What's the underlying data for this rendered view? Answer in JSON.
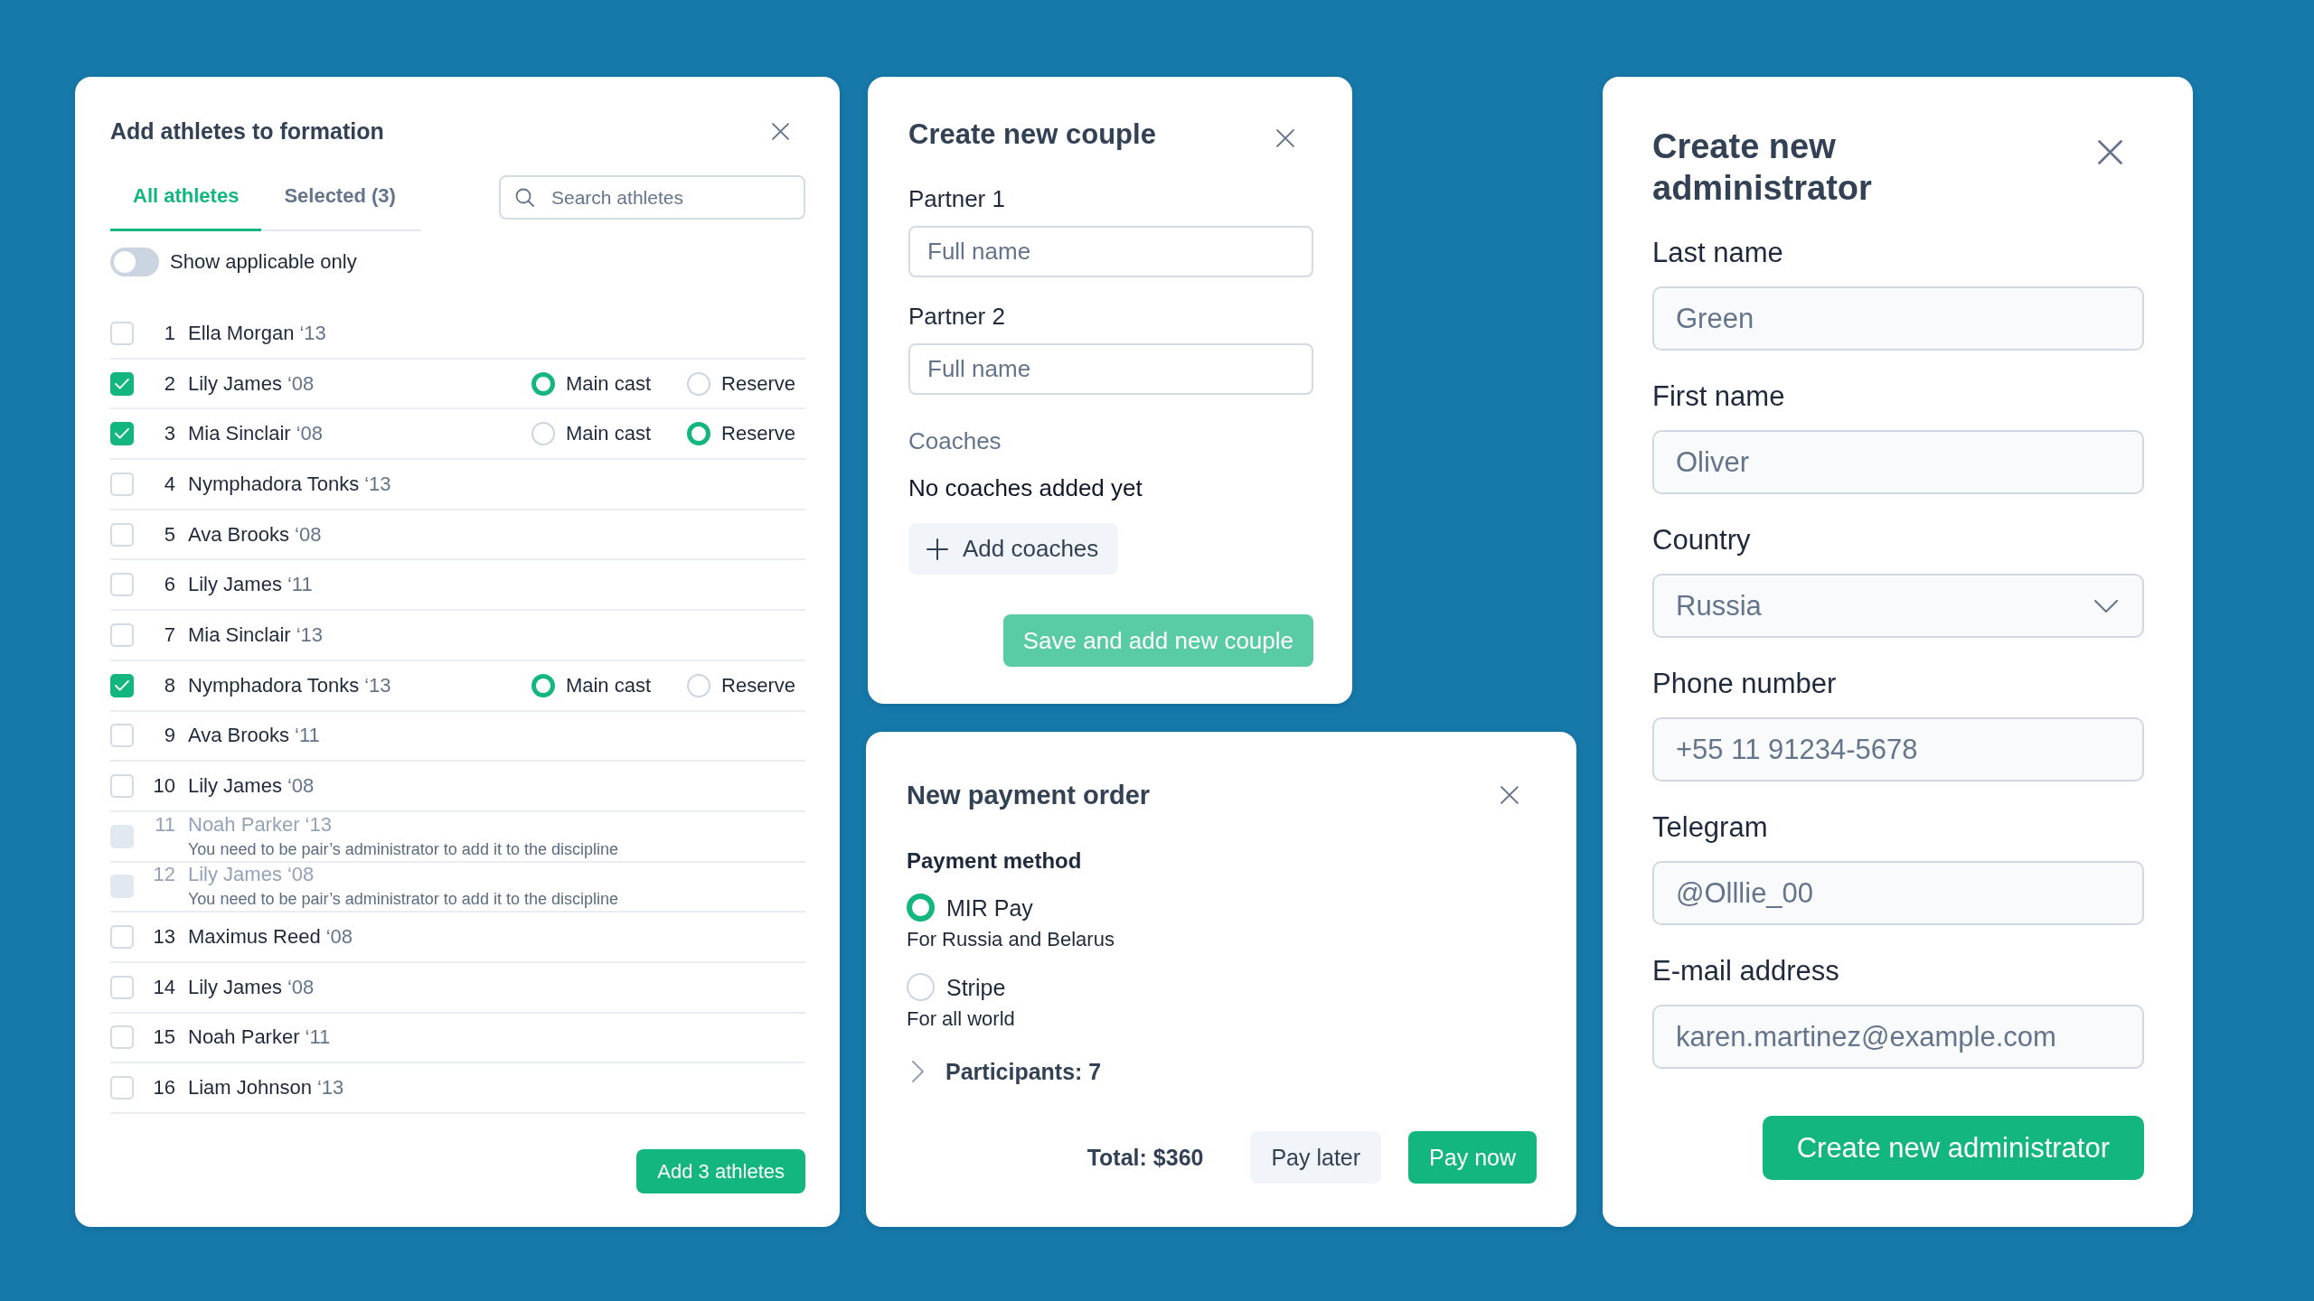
{
  "athletes_dialog": {
    "title": "Add athletes to formation",
    "tabs": [
      {
        "label": "All athletes",
        "selected": true
      },
      {
        "label": "Selected (3)",
        "selected": false
      }
    ],
    "search": {
      "placeholder": "Search athletes"
    },
    "applicable_toggle": {
      "label": "Show applicable only",
      "on": false
    },
    "athletes": [
      {
        "number": "1",
        "name": "Ella Morgan",
        "year": "‘13",
        "checked": false,
        "disabled": false
      },
      {
        "number": "2",
        "name": "Lily James",
        "year": "‘08",
        "checked": true,
        "disabled": false,
        "roles": [
          {
            "label": "Main cast",
            "selected": true
          },
          {
            "label": "Reserve",
            "selected": false
          }
        ]
      },
      {
        "number": "3",
        "name": "Mia Sinclair",
        "year": "‘08",
        "checked": true,
        "disabled": false,
        "roles": [
          {
            "label": "Main cast",
            "selected": false
          },
          {
            "label": "Reserve",
            "selected": true
          }
        ]
      },
      {
        "number": "4",
        "name": "Nymphadora Tonks",
        "year": "‘13",
        "checked": false,
        "disabled": false
      },
      {
        "number": "5",
        "name": "Ava Brooks",
        "year": "‘08",
        "checked": false,
        "disabled": false
      },
      {
        "number": "6",
        "name": "Lily James",
        "year": "‘11",
        "checked": false,
        "disabled": false
      },
      {
        "number": "7",
        "name": "Mia Sinclair",
        "year": "‘13",
        "checked": false,
        "disabled": false
      },
      {
        "number": "8",
        "name": "Nymphadora Tonks",
        "year": "‘13",
        "checked": true,
        "disabled": false,
        "roles": [
          {
            "label": "Main cast",
            "selected": true
          },
          {
            "label": "Reserve",
            "selected": false
          }
        ]
      },
      {
        "number": "9",
        "name": "Ava Brooks",
        "year": "‘11",
        "checked": false,
        "disabled": false
      },
      {
        "number": "10",
        "name": "Lily James",
        "year": "‘08",
        "checked": false,
        "disabled": false
      },
      {
        "number": "11",
        "name": "Noah Parker",
        "year": "‘13",
        "checked": false,
        "disabled": true,
        "note": "You need to be pair’s administrator to add it to the discipline"
      },
      {
        "number": "12",
        "name": "Lily James",
        "year": "‘08",
        "checked": false,
        "disabled": true,
        "note": "You need to be pair’s administrator to add it to the discipline"
      },
      {
        "number": "13",
        "name": "Maximus Reed",
        "year": "‘08",
        "checked": false,
        "disabled": false
      },
      {
        "number": "14",
        "name": "Lily James",
        "year": "‘08",
        "checked": false,
        "disabled": false
      },
      {
        "number": "15",
        "name": "Noah Parker",
        "year": "‘11",
        "checked": false,
        "disabled": false
      },
      {
        "number": "16",
        "name": "Liam Johnson",
        "year": "‘13",
        "checked": false,
        "disabled": false
      }
    ],
    "submit_button": "Add 3 athletes"
  },
  "couple_dialog": {
    "title": "Create new couple",
    "fields": [
      {
        "label": "Partner 1",
        "placeholder": "Full name"
      },
      {
        "label": "Partner 2",
        "placeholder": "Full name"
      }
    ],
    "coaches": {
      "label": "Coaches",
      "empty_text": "No coaches added yet",
      "add_button": "Add coaches"
    },
    "submit_button": {
      "label": "Save and add new couple",
      "disabled": true
    }
  },
  "payment_dialog": {
    "title": "New payment order",
    "method_label": "Payment method",
    "methods": [
      {
        "name": "MIR Pay",
        "description": "For Russia and Belarus",
        "selected": true
      },
      {
        "name": "Stripe",
        "description": "For all world",
        "selected": false
      }
    ],
    "participants": {
      "label": "Participants: 7",
      "expanded": false
    },
    "total": "Total: $360",
    "buttons": [
      {
        "label": "Pay later",
        "kind": "secondary"
      },
      {
        "label": "Pay now",
        "kind": "primary"
      }
    ]
  },
  "admin_dialog": {
    "title": "Create new administrator",
    "fields": [
      {
        "kind": "text",
        "label": "Last name",
        "value": "Green",
        "disabled": true
      },
      {
        "kind": "text",
        "label": "First name",
        "value": "Oliver",
        "disabled": true
      },
      {
        "kind": "select",
        "label": "Country",
        "value": "Russia",
        "disabled": true
      },
      {
        "kind": "text",
        "label": "Phone number",
        "value": "+55 11 91234-5678",
        "disabled": true
      },
      {
        "kind": "text",
        "label": "Telegram",
        "value": "@Olllie_00",
        "disabled": true
      },
      {
        "kind": "text",
        "label": "E-mail address",
        "value": "karen.martinez@example.com",
        "disabled": true
      }
    ],
    "submit_button": "Create new administrator"
  }
}
